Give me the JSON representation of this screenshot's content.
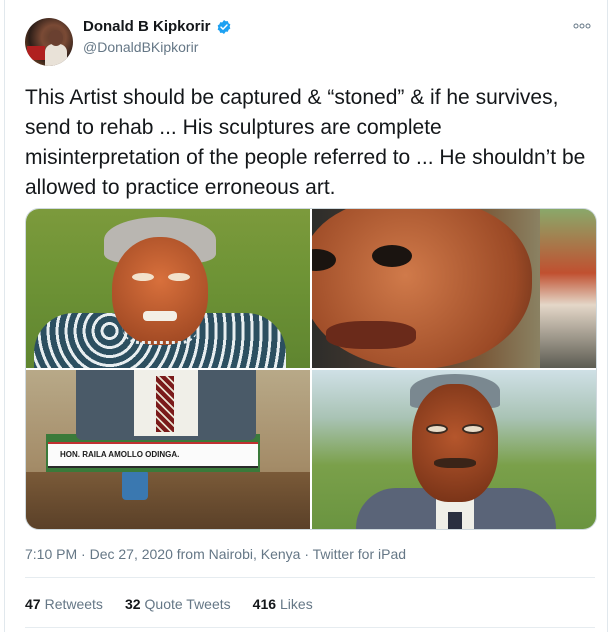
{
  "author": {
    "display_name": "Donald B Kipkorir",
    "handle": "@DonaldBKipkorir",
    "verified": true,
    "verified_icon": "verified-badge-icon"
  },
  "more_icon": "more-options-icon",
  "tweet": {
    "text": "This Artist should be captured & “stoned”  & if he survives, send to rehab ... His sculptures are complete misinterpretation of the people referred to ... He shouldn’t be allowed to practice erroneous art."
  },
  "media": {
    "plaque_text": "HON. RAILA AMOLLO ODINGA."
  },
  "meta": {
    "timestamp": "7:10 PM · Dec 27, 2020 from Nairobi, Kenya · Twitter for iPad"
  },
  "stats": {
    "retweets": {
      "count": "47",
      "label": "Retweets"
    },
    "quote_tweets": {
      "count": "32",
      "label": "Quote Tweets"
    },
    "likes": {
      "count": "416",
      "label": "Likes"
    }
  },
  "colors": {
    "text_primary": "#14171a",
    "text_secondary": "#657786",
    "verified_blue": "#1da1f2",
    "border": "#e1e8ed"
  }
}
